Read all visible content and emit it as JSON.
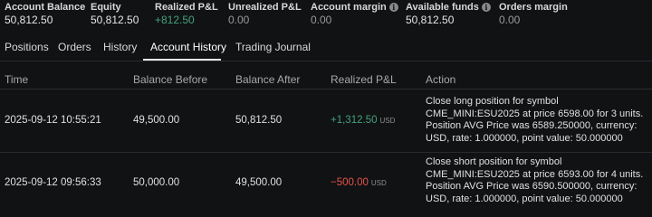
{
  "summary": {
    "account_balance": {
      "label": "Account Balance",
      "value": "50,812.50"
    },
    "equity": {
      "label": "Equity",
      "value": "50,812.50"
    },
    "realized_pnl": {
      "label": "Realized P&L",
      "value": "+812.50"
    },
    "unrealized_pnl": {
      "label": "Unrealized P&L",
      "value": "0.00"
    },
    "account_margin": {
      "label": "Account margin",
      "value": "0.00"
    },
    "available_funds": {
      "label": "Available funds",
      "value": "50,812.50"
    },
    "orders_margin": {
      "label": "Orders margin",
      "value": "0.00"
    }
  },
  "tabs": [
    "Positions",
    "Orders",
    "History",
    "Account History",
    "Trading Journal"
  ],
  "active_tab": "Account History",
  "table": {
    "headers": [
      "Time",
      "Balance Before",
      "Balance After",
      "Realized P&L",
      "Action"
    ],
    "rows": [
      {
        "time": "2025-09-12 10:55:21",
        "balance_before": "49,500.00",
        "balance_after": "50,812.50",
        "pnl": "+1,312.50",
        "currency": "USD",
        "action": "Close long position for symbol CME_MINI:ESU2025 at price 6598.00 for 3 units. Position AVG Price was 6589.250000, currency: USD, rate: 1.000000, point value: 50.000000"
      },
      {
        "time": "2025-09-12 09:56:33",
        "balance_before": "50,000.00",
        "balance_after": "49,500.00",
        "pnl": "−500.00",
        "currency": "USD",
        "action": "Close short position for symbol CME_MINI:ESU2025 at price 6593.00 for 4 units. Position AVG Price was 6590.500000, currency: USD, rate: 1.000000, point value: 50.000000"
      }
    ]
  },
  "colors": {
    "positive": "#43a37a",
    "negative": "#e5534b",
    "background": "#111214"
  }
}
